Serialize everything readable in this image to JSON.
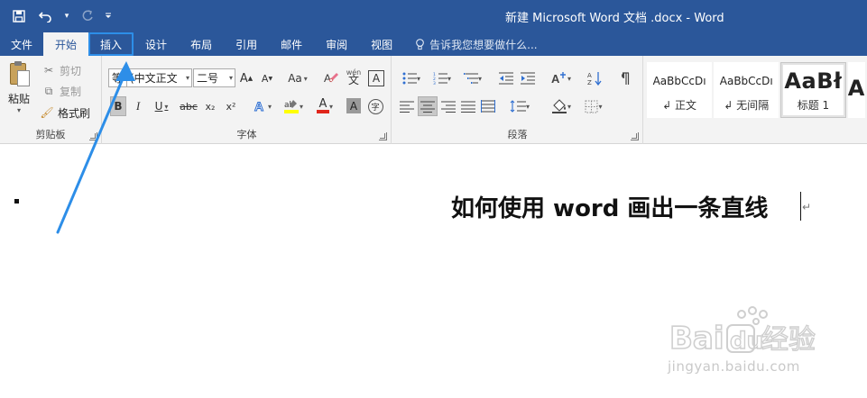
{
  "window": {
    "title": "新建 Microsoft Word 文档 .docx - Word"
  },
  "qat": {
    "save_icon": "save-icon",
    "undo_icon": "undo-icon",
    "redo_icon": "redo-icon",
    "customize_icon": "customize-qat-icon"
  },
  "tabs": [
    {
      "label": "文件"
    },
    {
      "label": "开始"
    },
    {
      "label": "插入"
    },
    {
      "label": "设计"
    },
    {
      "label": "布局"
    },
    {
      "label": "引用"
    },
    {
      "label": "邮件"
    },
    {
      "label": "审阅"
    },
    {
      "label": "视图"
    }
  ],
  "active_tab": "开始",
  "highlighted_tab": "插入",
  "tell_me": {
    "text": "告诉我您想要做什么..."
  },
  "clipboard": {
    "paste_label": "粘贴",
    "cut_label": "剪切",
    "copy_label": "复制",
    "format_painter_label": "格式刷",
    "group_label": "剪贴板"
  },
  "font": {
    "font_name_prefix": "等",
    "font_name": "(中文正文",
    "font_size": "二号",
    "grow_font": "A",
    "shrink_font": "A",
    "change_case": "Aa",
    "phonetic_top": "wén",
    "phonetic_bottom": "文",
    "char_border": "A",
    "bold": "B",
    "italic": "I",
    "underline": "U",
    "strikethrough": "abc",
    "subscript": "x₂",
    "superscript": "x²",
    "font_color": "A",
    "char_shading": "A",
    "enclose": "字",
    "group_label": "字体"
  },
  "paragraph": {
    "group_label": "段落"
  },
  "styles": {
    "items": [
      {
        "sample": "AaBbCcDı",
        "name": "↲ 正文"
      },
      {
        "sample": "AaBbCcDı",
        "name": "↲ 无间隔"
      },
      {
        "sample": "AaBł",
        "name": "标题 1"
      },
      {
        "sample": "A",
        "name": ""
      }
    ]
  },
  "document": {
    "heading": "如何使用 word 画出一条直线",
    "paragraph_mark": "↵"
  },
  "watermark": {
    "url": "jingyan.baidu.com"
  },
  "colors": {
    "title_bar": "#2b579a",
    "ribbon": "#f3f3f3",
    "highlight_box": "#2d8ee8",
    "annotation_arrow": "#2d8ee8",
    "font_color_bar": "#e0251b",
    "highlight_color_bar": "#ffff00"
  }
}
